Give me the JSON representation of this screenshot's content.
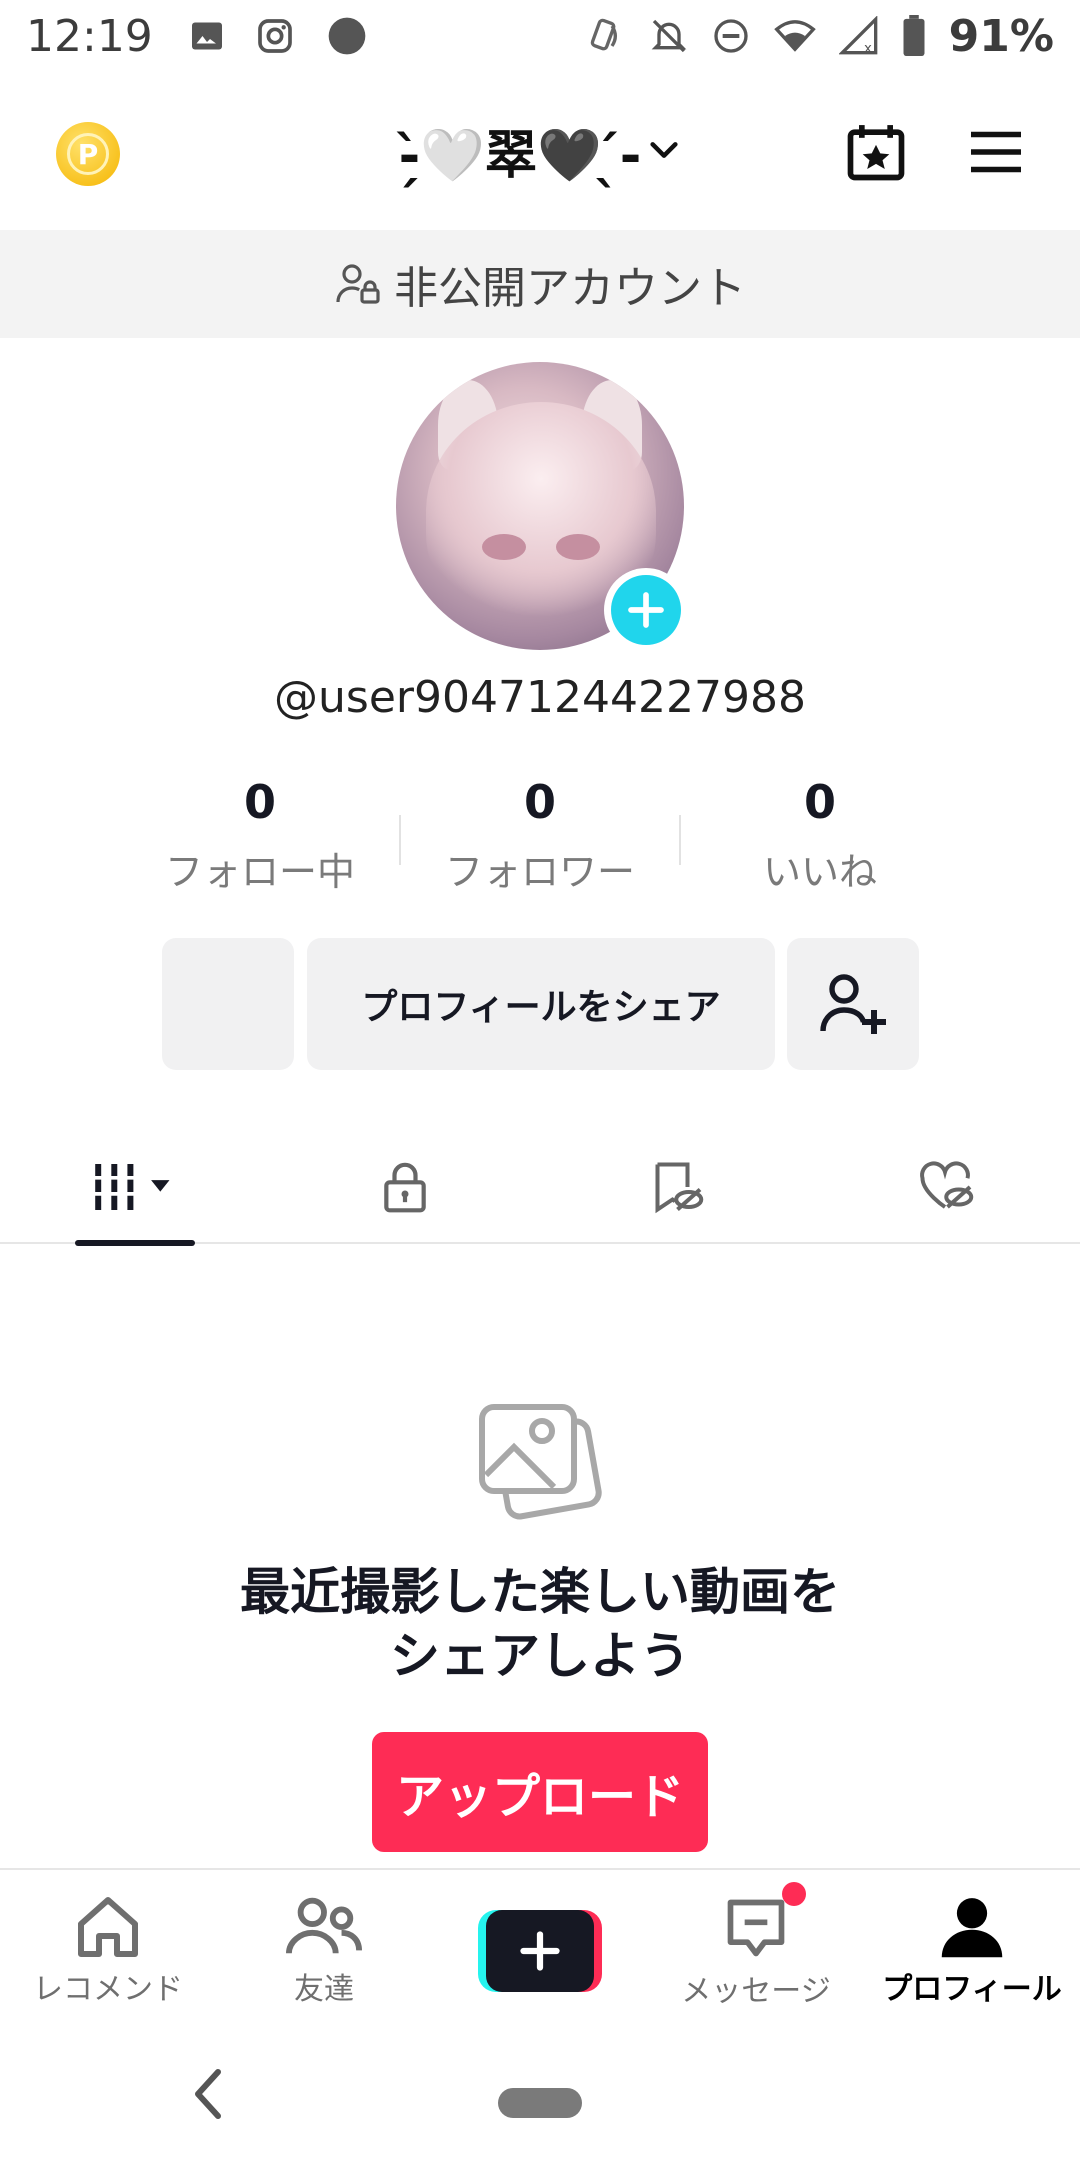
{
  "status_bar": {
    "time": "12:19",
    "battery": "91%",
    "left_icons": [
      "image-icon",
      "instagram-icon",
      "dot-icon"
    ],
    "right_icons": [
      "nfc-icon",
      "bell-off-icon",
      "dnd-icon",
      "wifi-icon",
      "signal-icon",
      "battery-icon"
    ]
  },
  "header": {
    "title": "-̗̀🤍翠🖤 ̖́-",
    "chevron_icon": "chevron-down-icon",
    "coin_icon": "coin-icon",
    "calendar_icon": "calendar-star-icon",
    "menu_icon": "menu-icon"
  },
  "private_banner": {
    "text": "非公開アカウント",
    "icon": "user-lock-icon"
  },
  "profile": {
    "handle": "@user90471244227988",
    "stats": [
      {
        "value": "0",
        "label": "フォロー中"
      },
      {
        "value": "0",
        "label": "フォロワー"
      },
      {
        "value": "0",
        "label": "いいね"
      }
    ]
  },
  "actions": {
    "share_label": "プロフィールをシェア",
    "add_friend_icon": "add-user-icon"
  },
  "tabs": [
    {
      "name": "videos",
      "icon": "grid-icon",
      "active": true
    },
    {
      "name": "private",
      "icon": "lock-icon",
      "active": false
    },
    {
      "name": "saved-hidden",
      "icon": "bookmark-hidden-icon",
      "active": false
    },
    {
      "name": "liked-hidden",
      "icon": "heart-hidden-icon",
      "active": false
    }
  ],
  "empty_state": {
    "title_line1": "最近撮影した楽しい動画を",
    "title_line2": "シェアしよう",
    "upload_label": "アップロード"
  },
  "bottom_nav": [
    {
      "label": "レコメンド",
      "icon": "home-icon"
    },
    {
      "label": "友達",
      "icon": "friends-icon"
    },
    {
      "label": "",
      "icon": "plus-icon"
    },
    {
      "label": "メッセージ",
      "icon": "inbox-icon"
    },
    {
      "label": "プロフィール",
      "icon": "profile-icon"
    }
  ],
  "colors": {
    "accent": "#fe2c55",
    "cyan": "#20d5ec",
    "text": "#161823"
  }
}
